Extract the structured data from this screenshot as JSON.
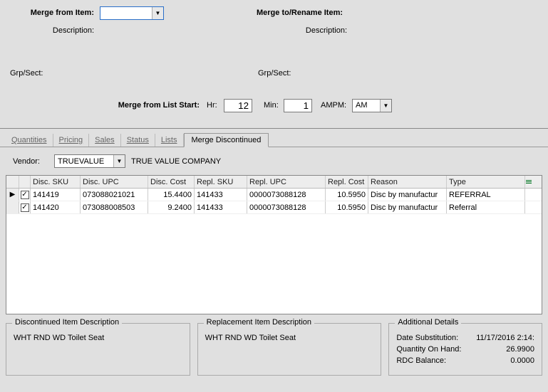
{
  "header": {
    "merge_from_label": "Merge from Item:",
    "merge_from_value": "",
    "merge_to_label": "Merge to/Rename Item:",
    "desc_label_left": "Description:",
    "desc_label_right": "Description:",
    "grp_label_left": "Grp/Sect:",
    "grp_label_right": "Grp/Sect:",
    "list_start_label": "Merge from List Start:",
    "hr_label": "Hr:",
    "hr_value": "12",
    "min_label": "Min:",
    "min_value": "1",
    "ampm_label": "AMPM:",
    "ampm_value": "AM"
  },
  "tabs": {
    "quantities": "Quantities",
    "pricing": "Pricing",
    "sales": "Sales",
    "status": "Status",
    "lists": "Lists",
    "merge_disc": "Merge Discontinued"
  },
  "vendor": {
    "label": "Vendor:",
    "value": "TRUEVALUE",
    "name": "TRUE VALUE COMPANY"
  },
  "grid": {
    "headers": {
      "sku": "Disc. SKU",
      "upc": "Disc. UPC",
      "cost": "Disc. Cost",
      "rsku": "Repl. SKU",
      "rupc": "Repl. UPC",
      "rcost": "Repl. Cost",
      "reason": "Reason",
      "type": "Type"
    },
    "rows": [
      {
        "selected": true,
        "ptr": "▶",
        "sku": "141419",
        "upc": "073088021021",
        "cost": "15.4400",
        "rsku": "141433",
        "rupc": "0000073088128",
        "rcost": "10.5950",
        "reason": "Disc by manufactur",
        "type": "REFERRAL"
      },
      {
        "selected": false,
        "ptr": "",
        "sku": "141420",
        "upc": "073088008503",
        "cost": "9.2400",
        "rsku": "141433",
        "rupc": "0000073088128",
        "rcost": "10.5950",
        "reason": "Disc by manufactur",
        "type": "Referral"
      }
    ]
  },
  "groups": {
    "disc_title": "Discontinued Item Description",
    "disc_text": "WHT RND WD Toilet Seat",
    "repl_title": "Replacement Item Description",
    "repl_text": "WHT RND WD Toilet Seat",
    "add_title": "Additional Details",
    "date_sub_label": "Date Substitution:",
    "date_sub_value": "11/17/2016 2:14:",
    "qoh_label": "Quantity On Hand:",
    "qoh_value": "26.9900",
    "rdc_label": "RDC Balance:",
    "rdc_value": "0.0000"
  },
  "checkmark": "✓"
}
